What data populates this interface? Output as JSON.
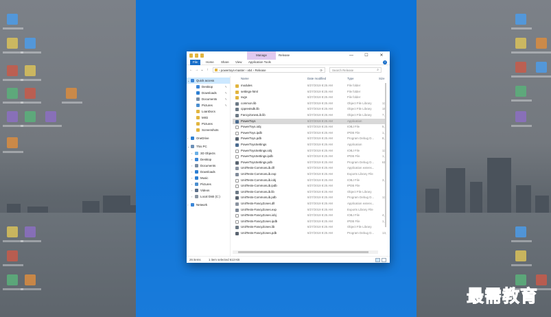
{
  "window": {
    "context_tab": "Manage",
    "title": "Release",
    "controls": {
      "minimize": "—",
      "maximize": "☐",
      "close": "✕"
    }
  },
  "ribbon": {
    "tabs": [
      "File",
      "Home",
      "Share",
      "View",
      "Application Tools"
    ]
  },
  "address": {
    "back": "←",
    "forward": "→",
    "recent": "⌄",
    "up": "↑",
    "path": "›  powertoys-master  ›  x64  ›  Release",
    "refresh": "⟳",
    "search_placeholder": "Search Release"
  },
  "nav": [
    {
      "label": "Quick access",
      "color": "#3a86d8",
      "indent": 1,
      "selected": true,
      "pin": false,
      "chevron": "⌄"
    },
    {
      "label": "Desktop",
      "color": "#3a86d8",
      "indent": 3,
      "selected": false,
      "pin": true,
      "chevron": ""
    },
    {
      "label": "Downloads",
      "color": "#2d7fd3",
      "indent": 3,
      "selected": false,
      "pin": true,
      "chevron": ""
    },
    {
      "label": "Documents",
      "color": "#7a8da3",
      "indent": 3,
      "selected": false,
      "pin": true,
      "chevron": ""
    },
    {
      "label": "Pictures",
      "color": "#4b8fd0",
      "indent": 3,
      "selected": false,
      "pin": true,
      "chevron": ""
    },
    {
      "label": "LoanDocs",
      "color": "#e2b53f",
      "indent": 3,
      "selected": false,
      "pin": false,
      "chevron": ""
    },
    {
      "label": "MIGi",
      "color": "#e2b53f",
      "indent": 3,
      "selected": false,
      "pin": false,
      "chevron": ""
    },
    {
      "label": "Pictures",
      "color": "#e2b53f",
      "indent": 3,
      "selected": false,
      "pin": false,
      "chevron": ""
    },
    {
      "label": "Screenshots",
      "color": "#e2b53f",
      "indent": 3,
      "selected": false,
      "pin": false,
      "chevron": ""
    },
    {
      "label": "OneDrive",
      "color": "#2d7fd3",
      "indent": 1,
      "selected": false,
      "pin": false,
      "chevron": "›"
    },
    {
      "label": "This PC",
      "color": "#6b90b8",
      "indent": 1,
      "selected": false,
      "pin": false,
      "chevron": "⌄"
    },
    {
      "label": "3D Objects",
      "color": "#6ab0e6",
      "indent": 2,
      "selected": false,
      "pin": false,
      "chevron": "›"
    },
    {
      "label": "Desktop",
      "color": "#3a86d8",
      "indent": 2,
      "selected": false,
      "pin": false,
      "chevron": "›"
    },
    {
      "label": "Documents",
      "color": "#7a8da3",
      "indent": 2,
      "selected": false,
      "pin": false,
      "chevron": "›"
    },
    {
      "label": "Downloads",
      "color": "#2d7fd3",
      "indent": 2,
      "selected": false,
      "pin": false,
      "chevron": "›"
    },
    {
      "label": "Music",
      "color": "#2d7fd3",
      "indent": 2,
      "selected": false,
      "pin": false,
      "chevron": "›"
    },
    {
      "label": "Pictures",
      "color": "#4b8fd0",
      "indent": 2,
      "selected": false,
      "pin": false,
      "chevron": "›"
    },
    {
      "label": "Videos",
      "color": "#5a6f8a",
      "indent": 2,
      "selected": false,
      "pin": false,
      "chevron": "›"
    },
    {
      "label": "Local Disk (C:)",
      "color": "#8a96a3",
      "indent": 2,
      "selected": false,
      "pin": false,
      "chevron": "›"
    },
    {
      "label": "Network",
      "color": "#3a86d8",
      "indent": 1,
      "selected": false,
      "pin": false,
      "chevron": "›"
    }
  ],
  "columns": [
    "Name",
    "Date modified",
    "Type",
    "Size"
  ],
  "files": [
    {
      "name": "modules",
      "date": "8/27/2019 8:25 AM",
      "type": "File folder",
      "size": "",
      "icon": "folder",
      "selected": false
    },
    {
      "name": "settings-html",
      "date": "8/27/2019 8:25 AM",
      "type": "File folder",
      "size": "",
      "icon": "folder",
      "selected": false
    },
    {
      "name": "svgs",
      "date": "8/27/2019 8:25 AM",
      "type": "File folder",
      "size": "",
      "icon": "folder",
      "selected": false
    },
    {
      "name": "common.lib",
      "date": "8/27/2019 8:25 AM",
      "type": "Object File Library",
      "size": "13,",
      "icon": "lib",
      "selected": false
    },
    {
      "name": "cpprestsdk.lib",
      "date": "8/27/2019 8:25 AM",
      "type": "Object File Library",
      "size": "15,",
      "icon": "lib",
      "selected": false
    },
    {
      "name": "FancyZonesLib.lib",
      "date": "8/27/2019 8:25 AM",
      "type": "Object File Library",
      "size": "7,",
      "icon": "lib",
      "selected": false
    },
    {
      "name": "PowerToys",
      "date": "8/27/2019 8:25 AM",
      "type": "Application",
      "size": "",
      "icon": "app",
      "selected": true
    },
    {
      "name": "PowerToys.iobj",
      "date": "8/27/2019 8:25 AM",
      "type": "IOBJ File",
      "size": "5,",
      "icon": "file",
      "selected": false
    },
    {
      "name": "PowerToys.ipdb",
      "date": "8/27/2019 8:25 AM",
      "type": "IPDB File",
      "size": "1,",
      "icon": "file",
      "selected": false
    },
    {
      "name": "PowerToys.pdb",
      "date": "8/27/2019 8:25 AM",
      "type": "Program Debug D...",
      "size": "8,",
      "icon": "pdb",
      "selected": false
    },
    {
      "name": "PowerToysSettings",
      "date": "8/27/2019 8:25 AM",
      "type": "Application",
      "size": "",
      "icon": "app",
      "selected": false
    },
    {
      "name": "PowerToysSettings.iobj",
      "date": "8/27/2019 8:25 AM",
      "type": "IOBJ File",
      "size": "13,",
      "icon": "file",
      "selected": false
    },
    {
      "name": "PowerToysSettings.ipdb",
      "date": "8/27/2019 8:25 AM",
      "type": "IPDB File",
      "size": "1,",
      "icon": "file",
      "selected": false
    },
    {
      "name": "PowerToysSettings.pdb",
      "date": "8/27/2019 8:25 AM",
      "type": "Program Debug D...",
      "size": "61,",
      "icon": "pdb",
      "selected": false
    },
    {
      "name": "UnitTests-CommonLib.dll",
      "date": "8/27/2019 8:25 AM",
      "type": "Application extens...",
      "size": "",
      "icon": "dll",
      "selected": false
    },
    {
      "name": "UnitTests-CommonLib.exp",
      "date": "8/27/2019 8:25 AM",
      "type": "Exports Library File",
      "size": "",
      "icon": "exp",
      "selected": false
    },
    {
      "name": "UnitTests-CommonLib.iobj",
      "date": "8/27/2019 8:25 AM",
      "type": "IOBJ File",
      "size": "3,",
      "icon": "file",
      "selected": false
    },
    {
      "name": "UnitTests-CommonLib.ipdb",
      "date": "8/27/2019 8:25 AM",
      "type": "IPDB File",
      "size": "",
      "icon": "file",
      "selected": false
    },
    {
      "name": "UnitTests-CommonLib.lib",
      "date": "8/27/2019 8:25 AM",
      "type": "Object File Library",
      "size": "",
      "icon": "lib",
      "selected": false
    },
    {
      "name": "UnitTests-CommonLib.pdb",
      "date": "8/27/2019 8:25 AM",
      "type": "Program Debug D...",
      "size": "13,",
      "icon": "pdb",
      "selected": false
    },
    {
      "name": "UnitTests-FancyZones.dll",
      "date": "8/27/2019 8:25 AM",
      "type": "Application extens...",
      "size": "",
      "icon": "dll",
      "selected": false
    },
    {
      "name": "UnitTests-FancyZones.exp",
      "date": "8/27/2019 8:25 AM",
      "type": "Exports Library File",
      "size": "",
      "icon": "exp",
      "selected": false
    },
    {
      "name": "UnitTests-FancyZones.iobj",
      "date": "8/27/2019 8:25 AM",
      "type": "IOBJ File",
      "size": "4,",
      "icon": "file",
      "selected": false
    },
    {
      "name": "UnitTests-FancyZones.ipdb",
      "date": "8/27/2019 8:25 AM",
      "type": "IPDB File",
      "size": "1,",
      "icon": "file",
      "selected": false
    },
    {
      "name": "UnitTests-FancyZones.lib",
      "date": "8/27/2019 8:25 AM",
      "type": "Object File Library",
      "size": "",
      "icon": "lib",
      "selected": false
    },
    {
      "name": "UnitTests-FancyZones.pdb",
      "date": "8/27/2019 8:25 AM",
      "type": "Program Debug D...",
      "size": "13,",
      "icon": "pdb",
      "selected": false
    }
  ],
  "status": {
    "item_count": "26 items",
    "selection": "1 item selected  613 KB"
  },
  "watermark": "最需教育",
  "colors": {
    "snap_zone": "#0d74d8",
    "selection": "#cce8ff",
    "folder": "#e2b53f",
    "accent": "#1a6fc9"
  },
  "icon_colors": {
    "folder": "#e2b53f",
    "lib": "#6d7a86",
    "app": "#4a6b8f",
    "file": "#ffffff",
    "pdb": "#5a6470",
    "dll": "#8a93a0",
    "exp": "#7f8a99"
  }
}
